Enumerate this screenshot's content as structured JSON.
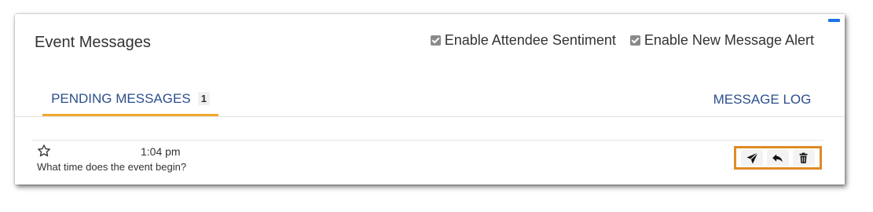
{
  "panel": {
    "title": "Event Messages",
    "options": [
      {
        "label": "Enable Attendee Sentiment",
        "checked": true
      },
      {
        "label": "Enable New Message Alert",
        "checked": true
      }
    ]
  },
  "tabs": {
    "pending_label": "PENDING MESSAGES",
    "pending_count": "1",
    "log_label": "MESSAGE LOG"
  },
  "messages": [
    {
      "time": "1:04 pm",
      "text": "What time does the event begin?",
      "icons": [
        "star-outline-icon",
        "send-icon",
        "reply-icon",
        "trash-icon"
      ]
    }
  ],
  "colors": {
    "accent": "#f0a830",
    "tab_text": "#2b4f8c",
    "highlight": "#e08a26",
    "corner_bar": "#1a73e8"
  }
}
